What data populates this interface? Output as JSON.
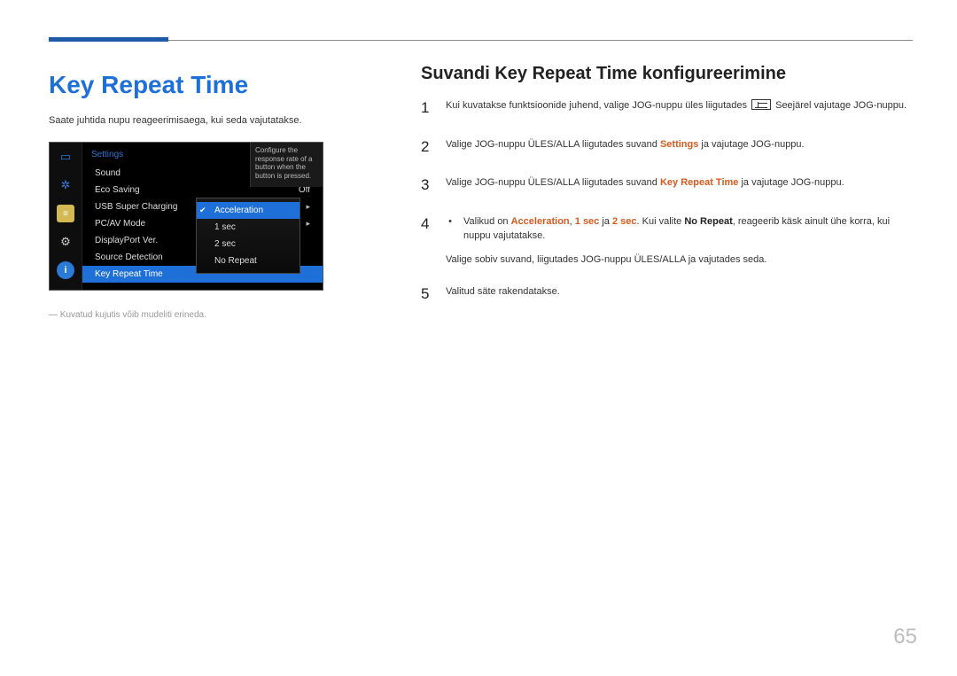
{
  "page": {
    "title": "Key Repeat Time",
    "intro": "Saate juhtida nupu reageerimisaega, kui seda vajutatakse.",
    "footnote": "Kuvatud kujutis võib mudeliti erineda.",
    "page_number": "65"
  },
  "right": {
    "subtitle": "Suvandi Key Repeat Time konfigureerimine",
    "steps": [
      {
        "num": "1",
        "text_a": "Kui kuvatakse funktsioonide juhend, valige JOG-nuppu üles liigutades ",
        "text_b": " Seejärel vajutage JOG-nuppu."
      },
      {
        "num": "2",
        "text_a": "Valige JOG-nuppu ÜLES/ALLA liigutades suvand ",
        "hl": "Settings",
        "text_b": " ja vajutage JOG-nuppu."
      },
      {
        "num": "3",
        "text_a": "Valige JOG-nuppu ÜLES/ALLA liigutades suvand ",
        "hl": "Key Repeat Time",
        "text_b": " ja vajutage JOG-nuppu."
      },
      {
        "num": "4",
        "bullet_a": "Valikud on ",
        "b1": "Acceleration",
        "b2": "1 sec",
        "b3": "2 sec",
        "bmid": " ja ",
        "b4": "No Repeat",
        "bullet_b": ", reageerib käsk ainult ühe korra, kui nuppu vajutatakse.",
        "bullet_mid": ". Kui valite ",
        "line2": "Valige sobiv suvand, liigutades JOG-nuppu ÜLES/ALLA ja vajutades seda."
      },
      {
        "num": "5",
        "text_a": "Valitud säte rakendatakse."
      }
    ]
  },
  "osd": {
    "header": "Settings",
    "rows": [
      {
        "label": "Sound",
        "val": "",
        "chev": true
      },
      {
        "label": "Eco Saving",
        "val": "Off"
      },
      {
        "label": "USB Super Charging",
        "chev": true
      },
      {
        "label": "PC/AV Mode",
        "chev": true
      },
      {
        "label": "DisplayPort Ver."
      },
      {
        "label": "Source Detection"
      },
      {
        "label": "Key Repeat Time",
        "sel": true
      }
    ],
    "sub": [
      "Acceleration",
      "1 sec",
      "2 sec",
      "No Repeat"
    ],
    "tip": "Configure the response rate of a button when the button is pressed."
  }
}
